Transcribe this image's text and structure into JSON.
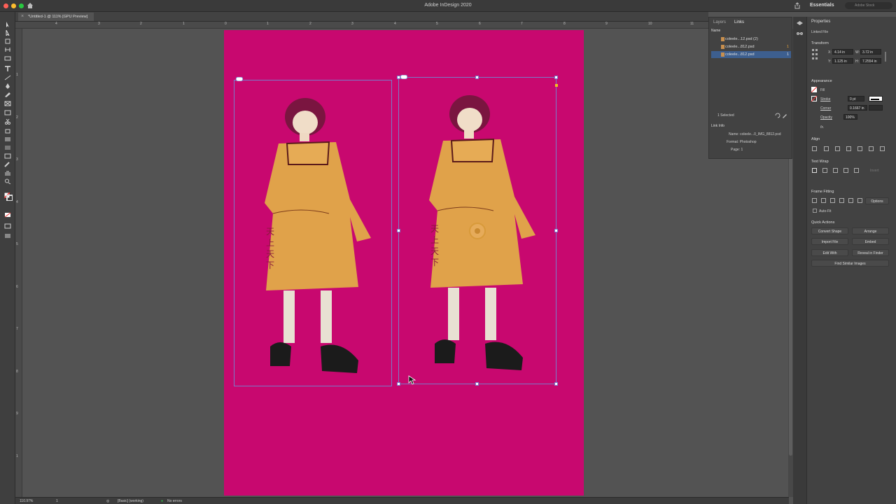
{
  "window": {
    "title": "Adobe InDesign 2020",
    "workspace": "Essentials",
    "search_placeholder": "Adobe Stock",
    "traffic_colors": [
      "#ff5f57",
      "#febc2e",
      "#28c840"
    ]
  },
  "document_tab": {
    "label": "*Untitled-1 @ 111% [GPU Preview]"
  },
  "ruler": {
    "h_labels": [
      "4",
      "3",
      "2",
      "1",
      "0",
      "1",
      "2",
      "3",
      "4",
      "5",
      "6",
      "7",
      "8",
      "9",
      "10",
      "11"
    ],
    "v_labels": [
      "1",
      "2",
      "3",
      "4",
      "5",
      "6",
      "7",
      "8",
      "9",
      "1"
    ]
  },
  "canvas": {
    "page_color": "#c8086f",
    "frame_color": "#7a7ac8"
  },
  "status": {
    "zoom": "110.97%",
    "page": "1",
    "preflight_profile": "[Basic] (working)",
    "errors": "No errors"
  },
  "links_panel": {
    "tabs": [
      "Layers",
      "Links"
    ],
    "column_header": "Name",
    "rows": [
      {
        "label": "coleele...12.psd (2)",
        "count": ""
      },
      {
        "label": "coleele...812.psd",
        "count": "1"
      },
      {
        "label": "coleele...812.psd",
        "count": "1"
      }
    ],
    "selected_count": "1 Selected",
    "link_info_title": "Link Info",
    "info": {
      "name": "Name: coleele...0_IMG_8812.psd",
      "format": "Format: Photoshop",
      "page": "Page: 1"
    }
  },
  "properties": {
    "title": "Properties",
    "subtitle": "Linked File",
    "transform": {
      "heading": "Transform",
      "x_label": "X:",
      "x": "4.14 in",
      "y_label": "Y:",
      "y": "1.125 in",
      "w_label": "W:",
      "w": "3.72 in",
      "h_label": "H:",
      "h": "7.2554 in"
    },
    "appearance": {
      "heading": "Appearance",
      "fill": "Fill",
      "stroke": "Stroke",
      "stroke_value": "0 pt",
      "corner": "Corner",
      "corner_value": "0.1667 in",
      "opacity": "Opacity",
      "opacity_value": "100%",
      "fx": "fx."
    },
    "align": {
      "heading": "Align"
    },
    "text_wrap": {
      "heading": "Text Wrap",
      "invert": "Invert"
    },
    "frame_fitting": {
      "heading": "Frame Fitting",
      "options": "Options",
      "auto_fit": "Auto-Fit"
    },
    "quick_actions": {
      "heading": "Quick Actions",
      "convert_shape": "Convert Shape",
      "arrange": "Arrange",
      "import_file": "Import File",
      "embed": "Embed",
      "edit_with": "Edit With",
      "reveal": "Reveal in Finder",
      "find_similar": "Find Similar Images"
    }
  }
}
